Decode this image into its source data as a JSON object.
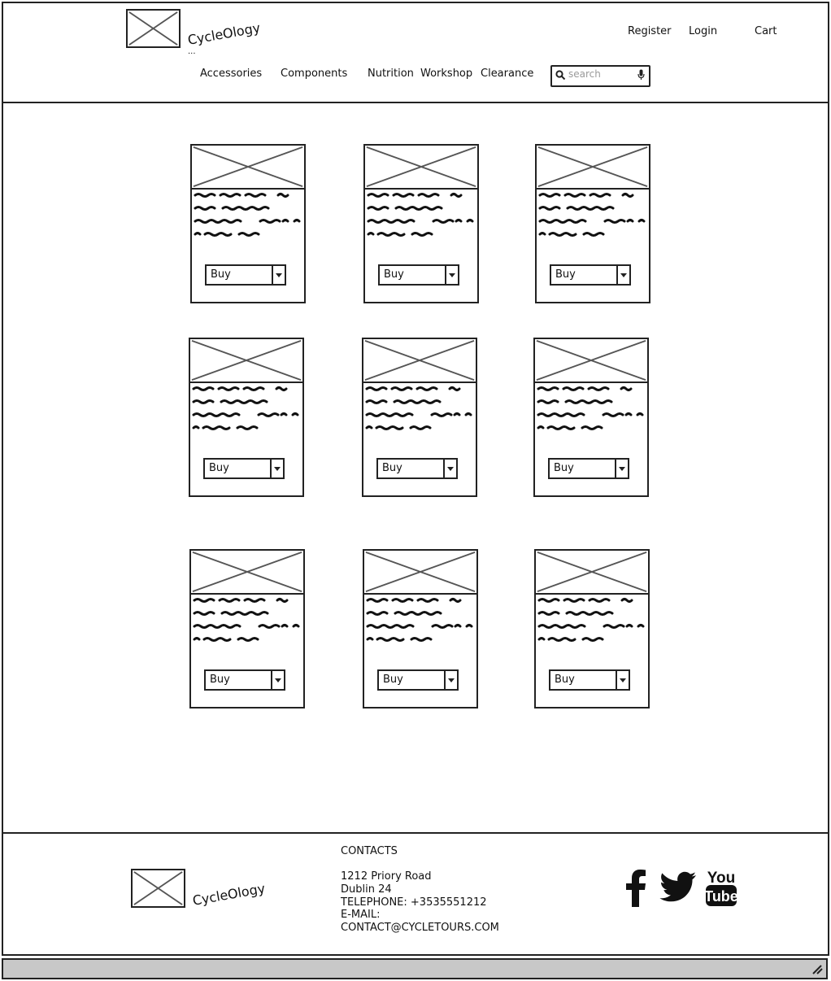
{
  "header": {
    "brand": "CycleOlogy",
    "tagline": "...",
    "links": {
      "register": "Register",
      "login": "Login",
      "cart": "Cart"
    },
    "nav": [
      "Accessories",
      "Components",
      "Nutrition",
      "Workshop",
      "Clearance"
    ],
    "search_placeholder": "search"
  },
  "products": [
    {
      "buy_label": "Buy"
    },
    {
      "buy_label": "Buy"
    },
    {
      "buy_label": "Buy"
    },
    {
      "buy_label": "Buy"
    },
    {
      "buy_label": "Buy"
    },
    {
      "buy_label": "Buy"
    },
    {
      "buy_label": "Buy"
    },
    {
      "buy_label": "Buy"
    },
    {
      "buy_label": "Buy"
    }
  ],
  "footer": {
    "brand": "CycleOlogy",
    "contacts_title": "CONTACTS",
    "address_line1": "1212  Priory Road",
    "address_line2": "Dublin 24",
    "telephone": "TELEPHONE:  +3535551212",
    "email_label": "E-MAIL:",
    "email": "CONTACT@CYCLETOURS.COM",
    "social": [
      "facebook-icon",
      "twitter-icon",
      "youtube-icon"
    ]
  }
}
